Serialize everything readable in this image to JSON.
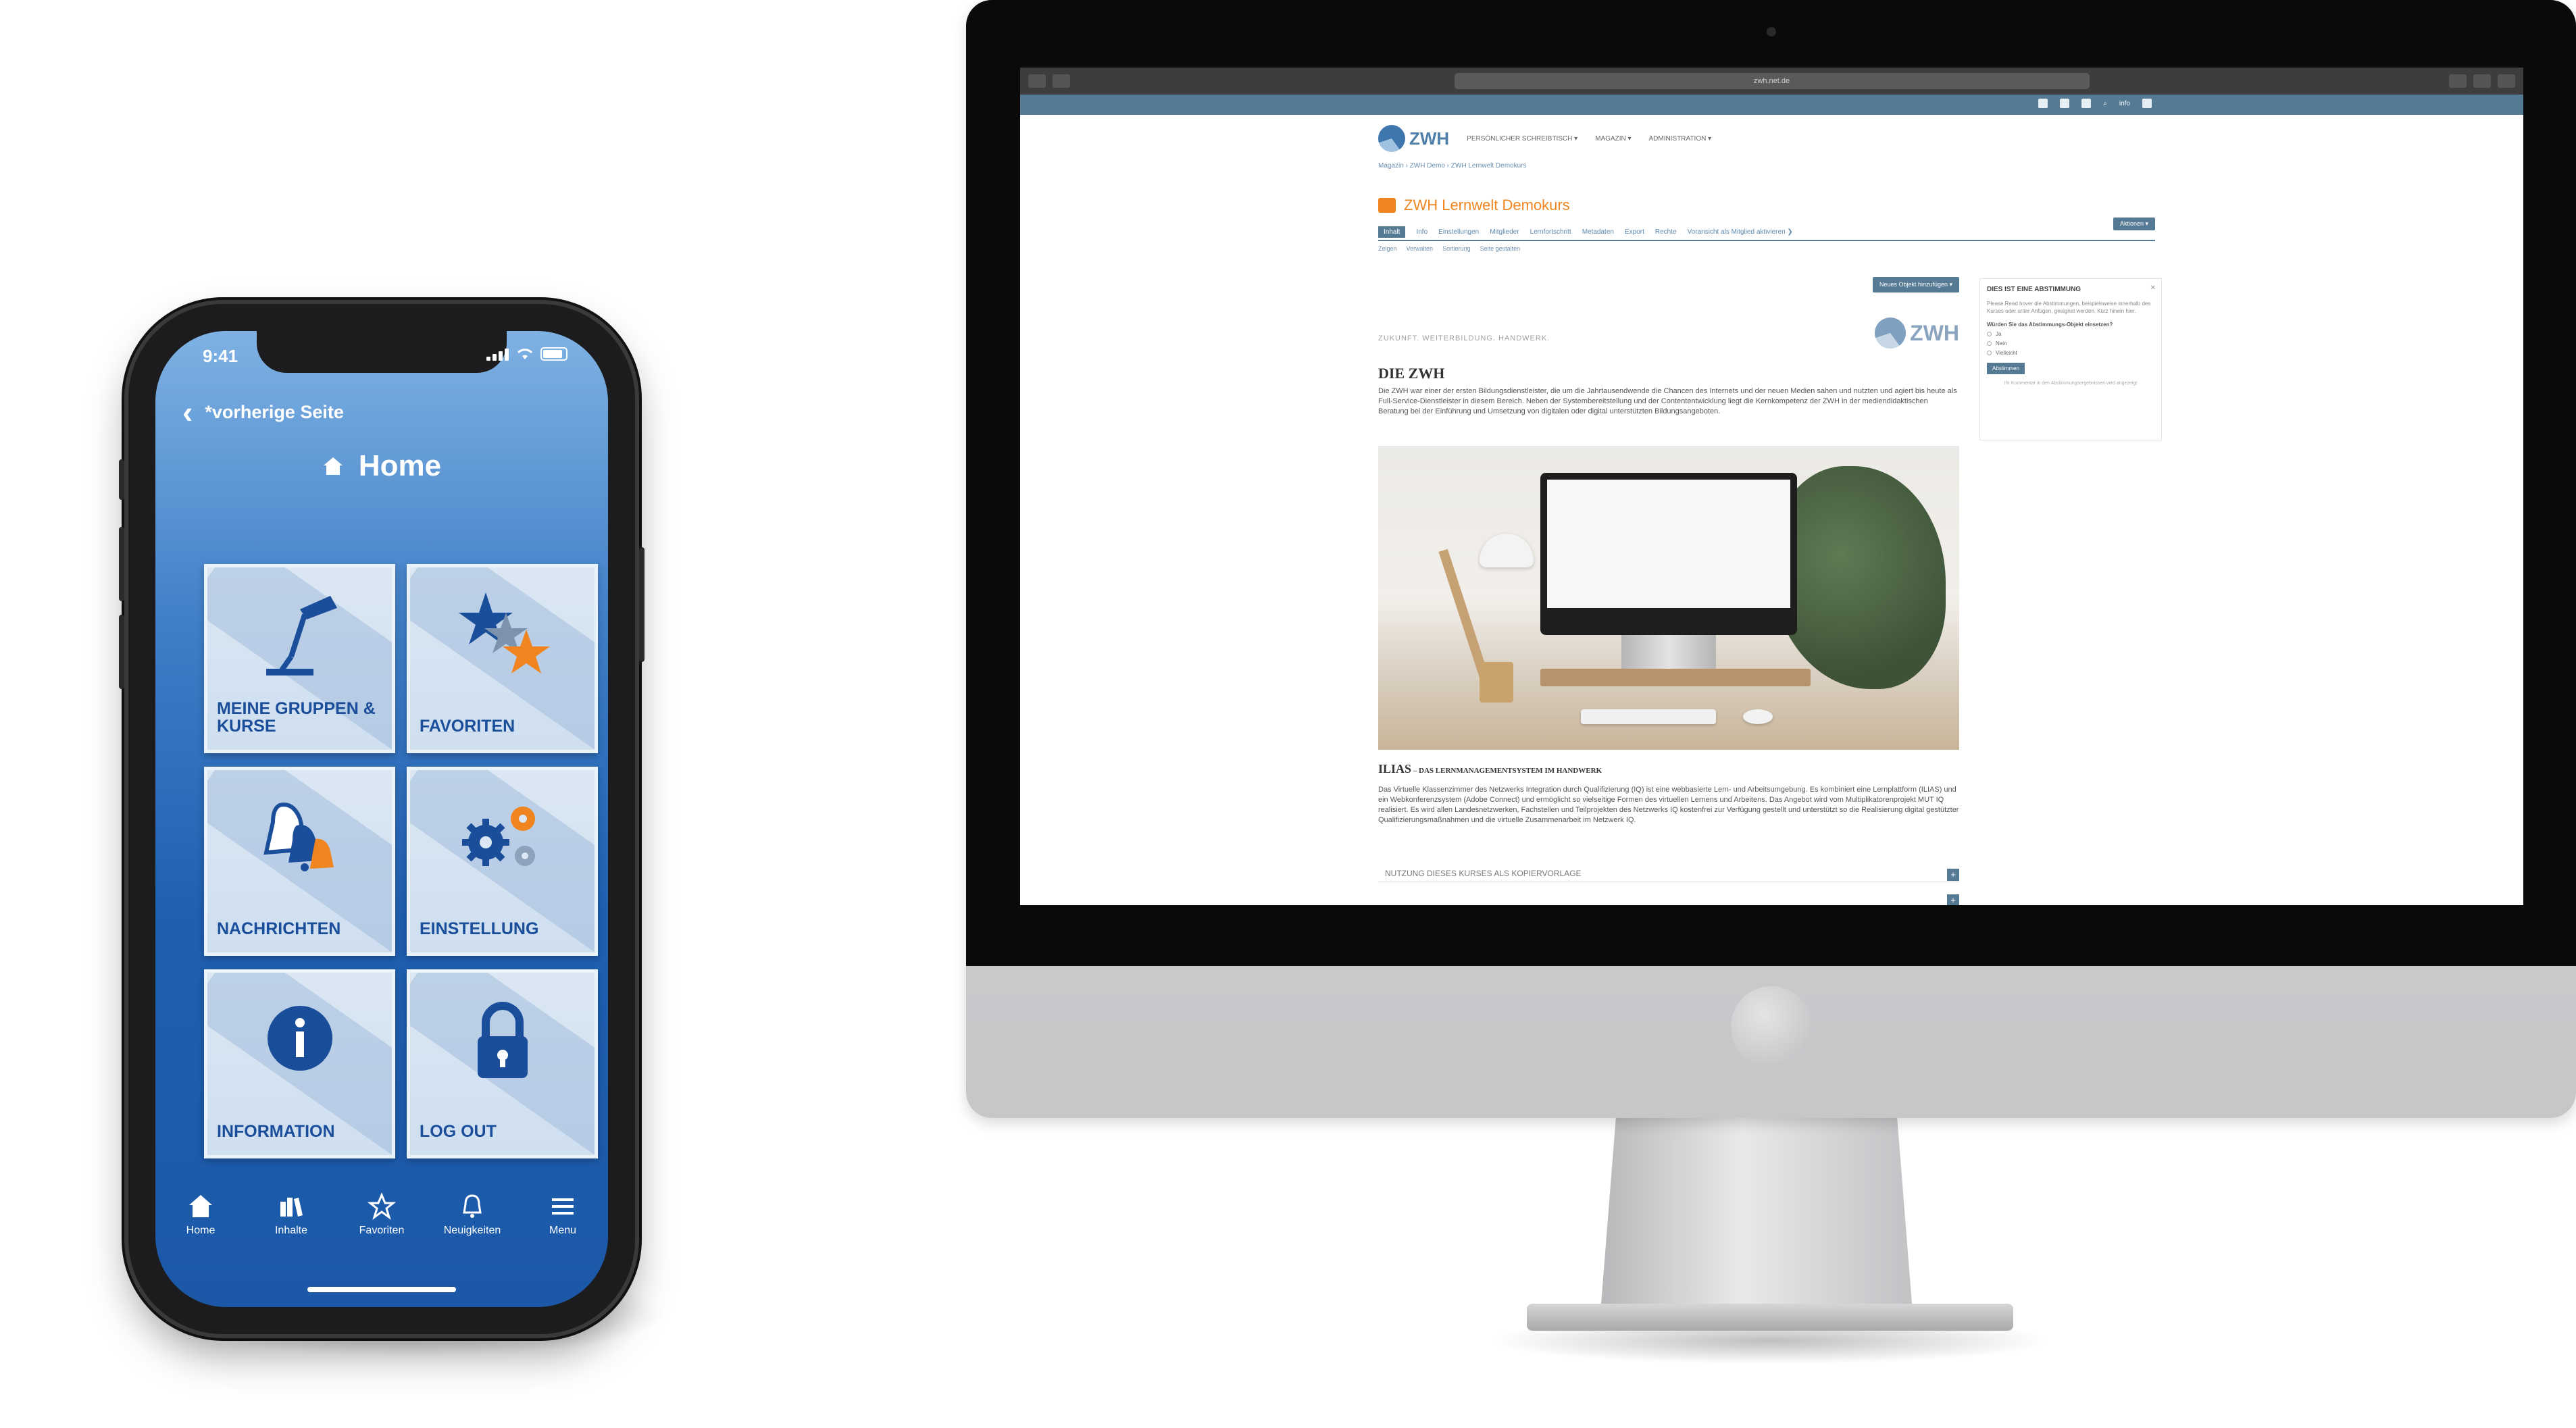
{
  "phone": {
    "status_time": "9:41",
    "back_label": "*vorherige Seite",
    "screen_title": "Home",
    "tiles": [
      {
        "label": "MEINE GRUPPEN & KURSE",
        "icon": "desk-lamp-icon"
      },
      {
        "label": "FAVORITEN",
        "icon": "stars-icon"
      },
      {
        "label": "NACHRICHTEN",
        "icon": "bells-icon"
      },
      {
        "label": "EINSTELLUNG",
        "icon": "gears-icon"
      },
      {
        "label": "INFORMATION",
        "icon": "info-icon"
      },
      {
        "label": "LOG OUT",
        "icon": "padlock-icon"
      }
    ],
    "tabbar": [
      {
        "label": "Home",
        "icon": "home-icon"
      },
      {
        "label": "Inhalte",
        "icon": "books-icon"
      },
      {
        "label": "Favoriten",
        "icon": "star-icon"
      },
      {
        "label": "Neuigkeiten",
        "icon": "bell-icon"
      },
      {
        "label": "Menu",
        "icon": "hamburger-icon"
      }
    ],
    "colors": {
      "accent": "#1b58a8",
      "tile_label": "#1a4e9a",
      "notification": "#f0841e"
    }
  },
  "desktop": {
    "browser": {
      "url": "zwh.net.de"
    },
    "top_bar": {
      "user": "info"
    },
    "logo_text": "ZWH",
    "nav": [
      "PERSÖNLICHER SCHREIBTISCH ▾",
      "MAGAZIN ▾",
      "ADMINISTRATION ▾"
    ],
    "breadcrumb": "Magazin  ›  ZWH Demo  ›  ZWH Lernwelt Demokurs",
    "course_title": "ZWH Lernwelt Demokurs",
    "actions_label": "Aktionen ▾",
    "tabs": [
      "Inhalt",
      "Info",
      "Einstellungen",
      "Mitglieder",
      "Lernfortschritt",
      "Metadaten",
      "Export",
      "Rechte",
      "Voransicht als Mitglied aktivieren ❯"
    ],
    "subtabs": [
      "Zeigen",
      "Verwalten",
      "Sortierung",
      "Seite gestalten"
    ],
    "add_button": "Neues Objekt hinzufügen ▾",
    "tagline": "ZUKUNFT. WEITERBILDUNG. HANDWERK.",
    "heading_1": "DIE ZWH",
    "paragraph_1": "Die ZWH war einer der ersten Bildungsdienstleister, die um die Jahrtausendwende die Chancen des Internets und der neuen Medien sahen und nutzten und agiert bis heute als Full-Service-Dienstleister in diesem Bereich. Neben der Systembereitstellung und der Contententwicklung liegt die Kernkompetenz der ZWH in der mediendidaktischen Beratung bei der Einführung und Umsetzung von digitalen oder digital unterstützten Bildungsangeboten.",
    "heading_2_main": "ILIAS",
    "heading_2_sub": " – das Lernmanagementsystem im Handwerk",
    "paragraph_2": "Das Virtuelle Klassenzimmer des Netzwerks Integration durch Qualifizierung (IQ) ist eine webbasierte Lern- und Arbeitsumgebung. Es kombiniert eine Lernplattform (ILIAS) und ein Webkonferenzsystem (Adobe Connect) und ermöglicht so vielseitige Formen des virtuellen Lernens und Arbeitens. Das Angebot wird vom Multiplikatorenprojekt MUT IQ realisiert. Es wird allen Landesnetzwerken, Fachstellen und Teilprojekten des Netzwerks IQ kostenfrei zur Verfügung gestellt und unterstützt so die Realisierung digital gestützter Qualifizierungsmaßnahmen und die virtuelle Zusammenarbeit im Netzwerk IQ.",
    "accordion_1": "NUTZUNG DIESES KURSES ALS KOPIERVORLAGE",
    "accordion_2": "",
    "sidebar": {
      "title": "DIES IST EINE ABSTIMMUNG",
      "text": "Please Read hover die Abstimmungen, beispielsweise innerhalb des Kurses oder unter Anfügen, geeignet werden. Kurz hinein hier.",
      "question": "Würden Sie das Abstimmungs-Objekt einsetzen?",
      "options": [
        "Ja",
        "Nein",
        "Vielleicht"
      ],
      "button": "Abstimmen",
      "footer": "Ihr Kommentar in den Abstimmungsergebnissen wird angezeigt"
    },
    "colors": {
      "brand": "#557a94",
      "course_accent": "#f0841e",
      "link": "#5d8ab0"
    }
  }
}
